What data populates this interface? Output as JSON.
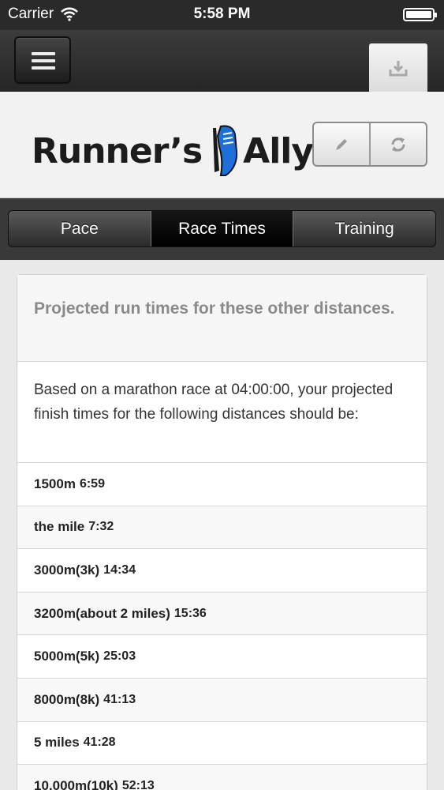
{
  "status_bar": {
    "carrier": "Carrier",
    "time": "5:58 PM"
  },
  "toolbar": {
    "menu_icon": "hamburger-icon",
    "download_icon": "download-icon"
  },
  "header": {
    "logo_text_left": "Runner’s",
    "logo_text_right": "Ally",
    "edit_icon": "pencil-icon",
    "refresh_icon": "refresh-icon"
  },
  "tabs": [
    {
      "label": "Pace"
    },
    {
      "label": "Race Times"
    },
    {
      "label": "Training"
    }
  ],
  "card": {
    "title": "Projected run times for these other distances.",
    "description": "Based on a marathon race at 04:00:00, your projected finish times for the following distances should be:",
    "rows": [
      {
        "distance": "1500m",
        "time": "6:59"
      },
      {
        "distance": "the mile",
        "time": "7:32"
      },
      {
        "distance": "3000m(3k)",
        "time": "14:34"
      },
      {
        "distance": "3200m(about 2 miles)",
        "time": "15:36"
      },
      {
        "distance": "5000m(5k)",
        "time": "25:03"
      },
      {
        "distance": "8000m(8k)",
        "time": "41:13"
      },
      {
        "distance": "5 miles",
        "time": "41:28"
      },
      {
        "distance": "10,000m(10k)",
        "time": "52:13"
      }
    ]
  },
  "colors": {
    "toolbar": "#2a2a2a",
    "logo_shoe": "#1e6fd9",
    "active_tab": "#000000"
  }
}
